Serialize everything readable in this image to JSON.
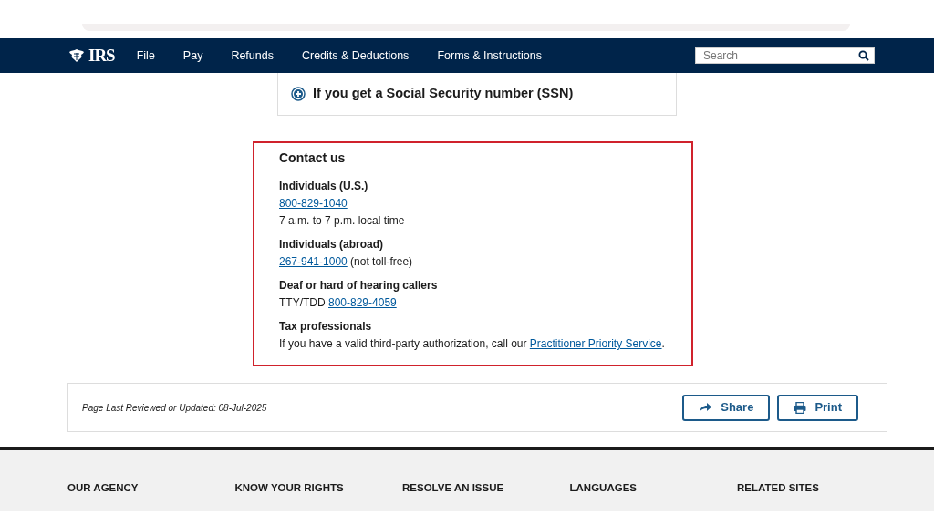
{
  "navbar": {
    "logo": "IRS",
    "items": [
      "File",
      "Pay",
      "Refunds",
      "Credits & Deductions",
      "Forms & Instructions"
    ],
    "search": {
      "placeholder": "Search"
    }
  },
  "accordion": {
    "title": "If you get a Social Security number (SSN)",
    "expanded": false
  },
  "contact": {
    "title": "Contact us",
    "highlighted": true,
    "sections": [
      {
        "heading": "Individuals (U.S.)",
        "lines": [
          [
            {
              "kind": "link",
              "text": "800-829-1040"
            }
          ],
          [
            {
              "kind": "text",
              "text": "7 a.m. to 7 p.m. local time"
            }
          ]
        ]
      },
      {
        "heading": "Individuals (abroad)",
        "lines": [
          [
            {
              "kind": "link",
              "text": "267-941-1000"
            },
            {
              "kind": "text",
              "text": " (not toll-free)"
            }
          ]
        ]
      },
      {
        "heading": "Deaf or hard of hearing callers",
        "lines": [
          [
            {
              "kind": "text",
              "text": "TTY/TDD "
            },
            {
              "kind": "link",
              "text": "800-829-4059"
            }
          ]
        ]
      },
      {
        "heading": "Tax professionals",
        "lines": [
          [
            {
              "kind": "text",
              "text": "If you have a valid third-party authorization, call our "
            },
            {
              "kind": "link",
              "text": "Practitioner Priority Service"
            },
            {
              "kind": "text",
              "text": "."
            }
          ]
        ]
      }
    ]
  },
  "page_info": {
    "reviewed": "Page Last Reviewed or Updated: 08-Jul-2025",
    "buttons": [
      {
        "kind": "share",
        "label": "Share"
      },
      {
        "kind": "print",
        "label": "Print"
      }
    ]
  },
  "footer": {
    "columns": [
      "OUR AGENCY",
      "KNOW YOUR RIGHTS",
      "RESOLVE AN ISSUE",
      "LANGUAGES",
      "RELATED SITES"
    ]
  }
}
